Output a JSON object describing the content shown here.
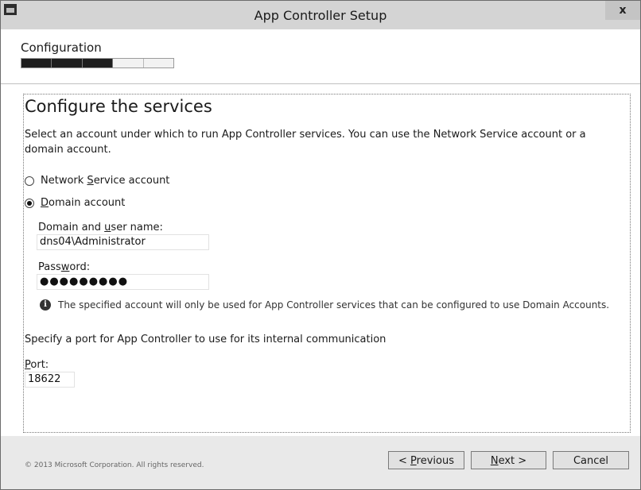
{
  "window": {
    "title": "App Controller Setup",
    "close_glyph": "x"
  },
  "header": {
    "title": "Configuration",
    "progress": {
      "total_steps": 5,
      "completed_steps": 3
    }
  },
  "main": {
    "heading": "Configure the services",
    "description": "Select an account under which to run App Controller services. You can use the Network Service account or a domain account.",
    "radios": {
      "network": {
        "label_pre": "Network ",
        "label_key": "S",
        "label_post": "ervice account",
        "selected": false
      },
      "domain": {
        "label_pre": "",
        "label_key": "D",
        "label_post": "omain account",
        "selected": true
      }
    },
    "domain_user": {
      "label_pre": "Domain and ",
      "label_key": "u",
      "label_post": "ser name:",
      "value": "dns04\\Administrator"
    },
    "password": {
      "label_pre": "Pass",
      "label_key": "w",
      "label_post": "ord:",
      "value": "●●●●●●●●●"
    },
    "info_text": "The specified account will only be used for App Controller services that can be configured to use Domain Accounts.",
    "port_description": "Specify a port for App Controller to use for its internal communication",
    "port": {
      "label_pre": "",
      "label_key": "P",
      "label_post": "ort:",
      "value": "18622"
    }
  },
  "footer": {
    "copyright": "© 2013 Microsoft Corporation. All rights reserved.",
    "previous": {
      "pre": "< ",
      "key": "P",
      "post": "revious"
    },
    "next": {
      "pre": "",
      "key": "N",
      "post": "ext >"
    },
    "cancel": "Cancel"
  },
  "icons": {
    "app": "window-app-icon",
    "close": "close-icon",
    "info": "info-icon"
  }
}
